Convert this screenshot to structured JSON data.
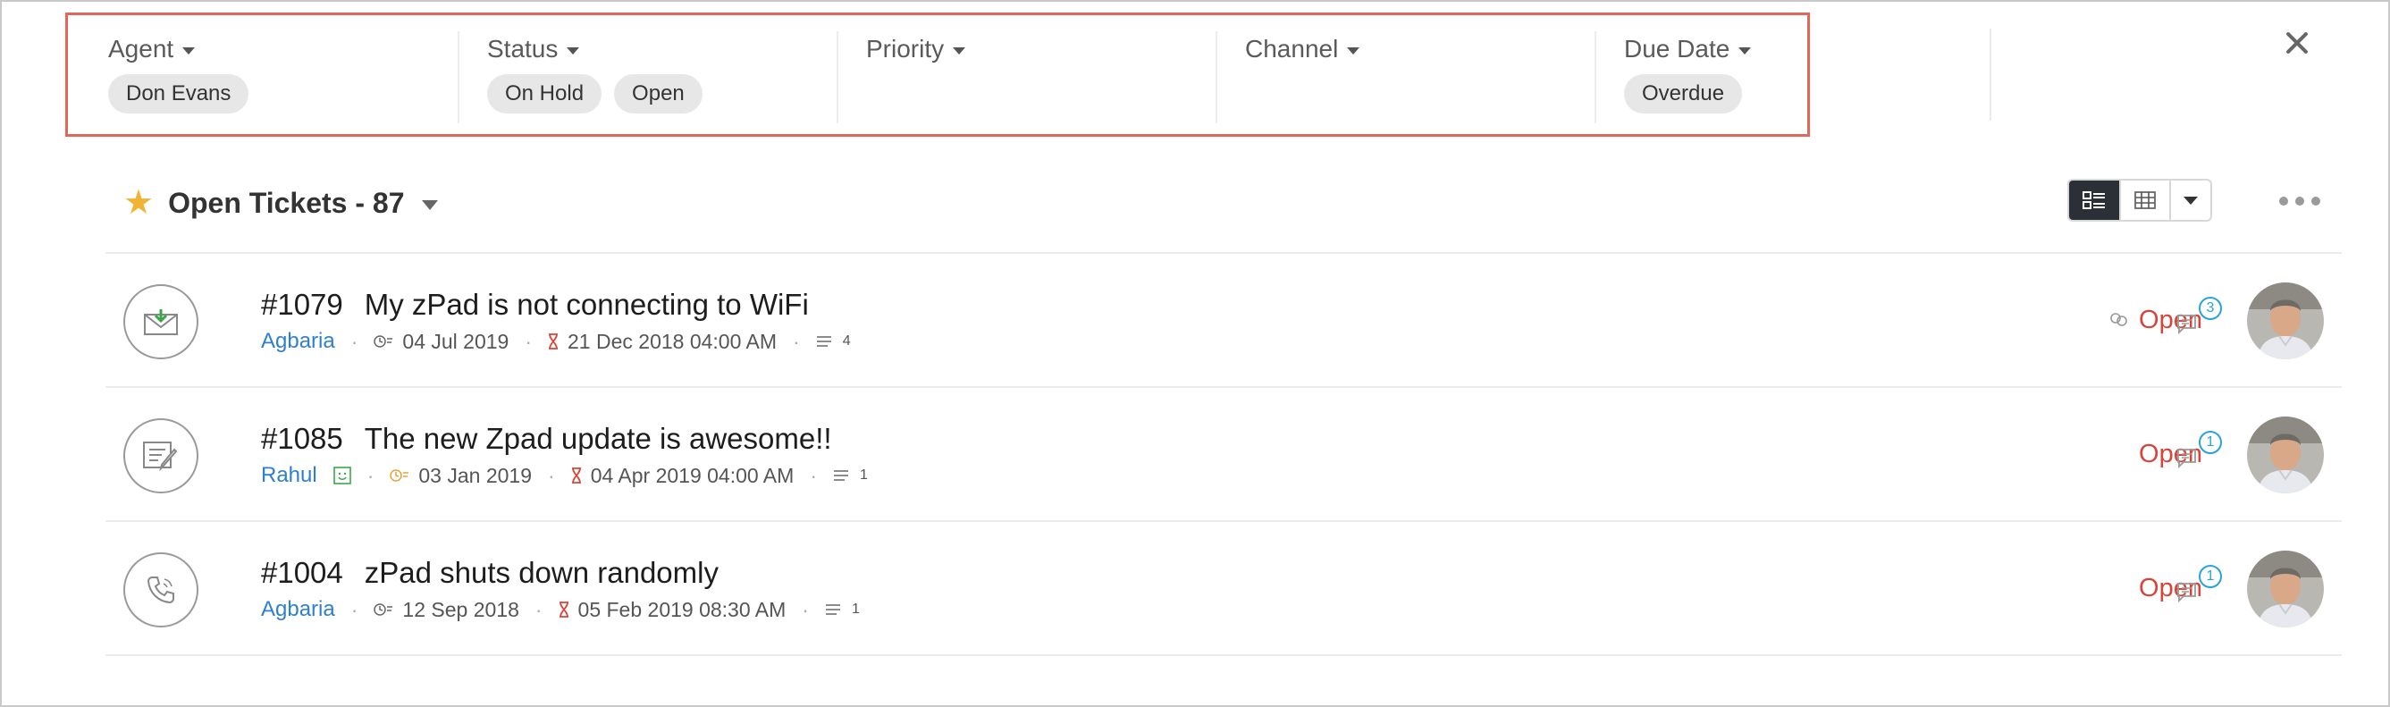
{
  "filters": {
    "agent": {
      "label": "Agent",
      "chips": [
        "Don Evans"
      ]
    },
    "status": {
      "label": "Status",
      "chips": [
        "On Hold",
        "Open"
      ]
    },
    "priority": {
      "label": "Priority",
      "chips": []
    },
    "channel": {
      "label": "Channel",
      "chips": []
    },
    "due_date": {
      "label": "Due Date",
      "chips": [
        "Overdue"
      ]
    }
  },
  "view": {
    "title": "Open Tickets - 87",
    "star_icon": "star-icon",
    "list_view_icon": "list-view-icon",
    "table_view_icon": "table-view-icon",
    "more_icon": "more-dots-icon"
  },
  "tickets": [
    {
      "id": "#1079",
      "subject": "My zPad is not connecting to WiFi",
      "agent": "Agbaria",
      "created": "04 Jul 2019",
      "due": "21 Dec 2018 04:00 AM",
      "threads": "4",
      "status": "Open",
      "comments": "3",
      "channel_icon": "email-icon"
    },
    {
      "id": "#1085",
      "subject": "The new Zpad update is awesome!!",
      "agent": "Rahul",
      "created": "03 Jan 2019",
      "due": "04 Apr 2019 04:00 AM",
      "threads": "1",
      "status": "Open",
      "comments": "1",
      "channel_icon": "web-form-icon"
    },
    {
      "id": "#1004",
      "subject": "zPad shuts down randomly",
      "agent": "Agbaria",
      "created": "12 Sep 2018",
      "due": "05 Feb 2019 08:30 AM",
      "threads": "1",
      "status": "Open",
      "comments": "1",
      "channel_icon": "phone-icon"
    }
  ],
  "colors": {
    "accent_border": "#e0675a",
    "status_open": "#d9443a",
    "agent_link": "#2f7fd1",
    "star": "#f1b334",
    "badge": "#2aa3d6"
  }
}
